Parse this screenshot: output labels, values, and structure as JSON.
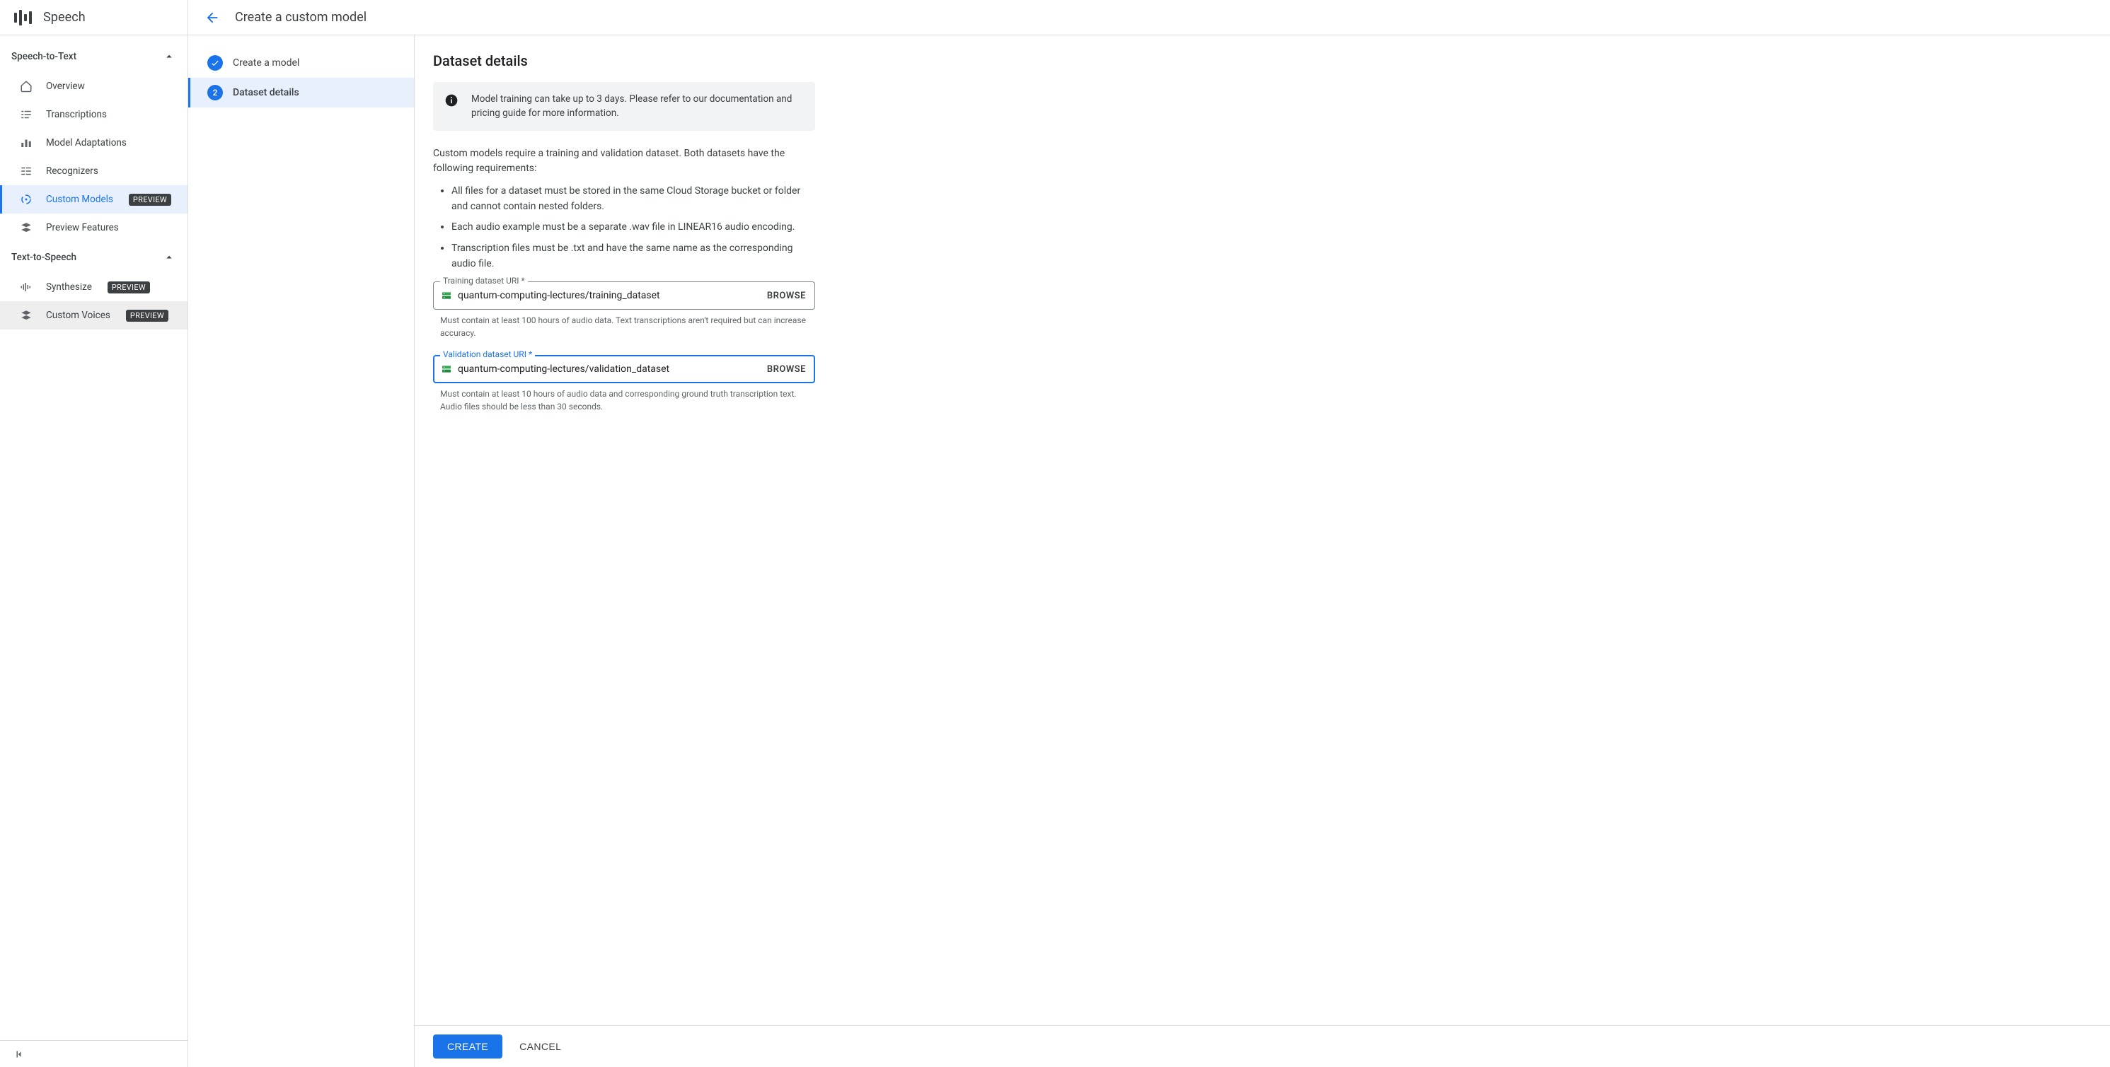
{
  "product": {
    "title": "Speech"
  },
  "sidebar": {
    "sections": [
      {
        "title": "Speech-to-Text",
        "items": [
          {
            "label": "Overview",
            "icon": "home-icon"
          },
          {
            "label": "Transcriptions",
            "icon": "lines-icon"
          },
          {
            "label": "Model Adaptations",
            "icon": "bars-icon"
          },
          {
            "label": "Recognizers",
            "icon": "list-icon"
          },
          {
            "label": "Custom Models",
            "icon": "loop-icon",
            "badge": "PREVIEW",
            "selected": true
          },
          {
            "label": "Preview Features",
            "icon": "stacks-icon"
          }
        ]
      },
      {
        "title": "Text-to-Speech",
        "items": [
          {
            "label": "Synthesize",
            "icon": "wave-icon",
            "badge": "PREVIEW"
          },
          {
            "label": "Custom Voices",
            "icon": "stacks-icon",
            "badge": "PREVIEW",
            "hover": true
          }
        ]
      }
    ]
  },
  "header": {
    "page_title": "Create a custom model"
  },
  "stepper": {
    "steps": [
      {
        "label": "Create a model",
        "state": "done"
      },
      {
        "label": "Dataset details",
        "state": "active",
        "number": "2"
      }
    ]
  },
  "content": {
    "heading": "Dataset details",
    "callout": "Model training can take up to 3 days. Please refer to our documentation and pricing guide for more information.",
    "intro": "Custom models require a training and validation dataset. Both datasets have the following requirements:",
    "requirements": [
      "All files for a dataset must be stored in the same Cloud Storage bucket or folder and cannot contain nested folders.",
      "Each audio example must be a separate .wav file in LINEAR16 audio encoding.",
      "Transcription files must be .txt and have the same name as the corresponding audio file."
    ],
    "fields": {
      "training": {
        "label": "Training dataset URI *",
        "value": "quantum-computing-lectures/training_dataset",
        "browse": "BROWSE",
        "helper": "Must contain at least 100 hours of audio data. Text transcriptions aren't required but can increase accuracy."
      },
      "validation": {
        "label": "Validation dataset URI *",
        "value": "quantum-computing-lectures/validation_dataset",
        "browse": "BROWSE",
        "helper": "Must contain at least 10 hours of audio data and corresponding ground truth transcription text. Audio files should be less than 30 seconds."
      }
    }
  },
  "footer": {
    "primary": "CREATE",
    "secondary": "CANCEL"
  }
}
